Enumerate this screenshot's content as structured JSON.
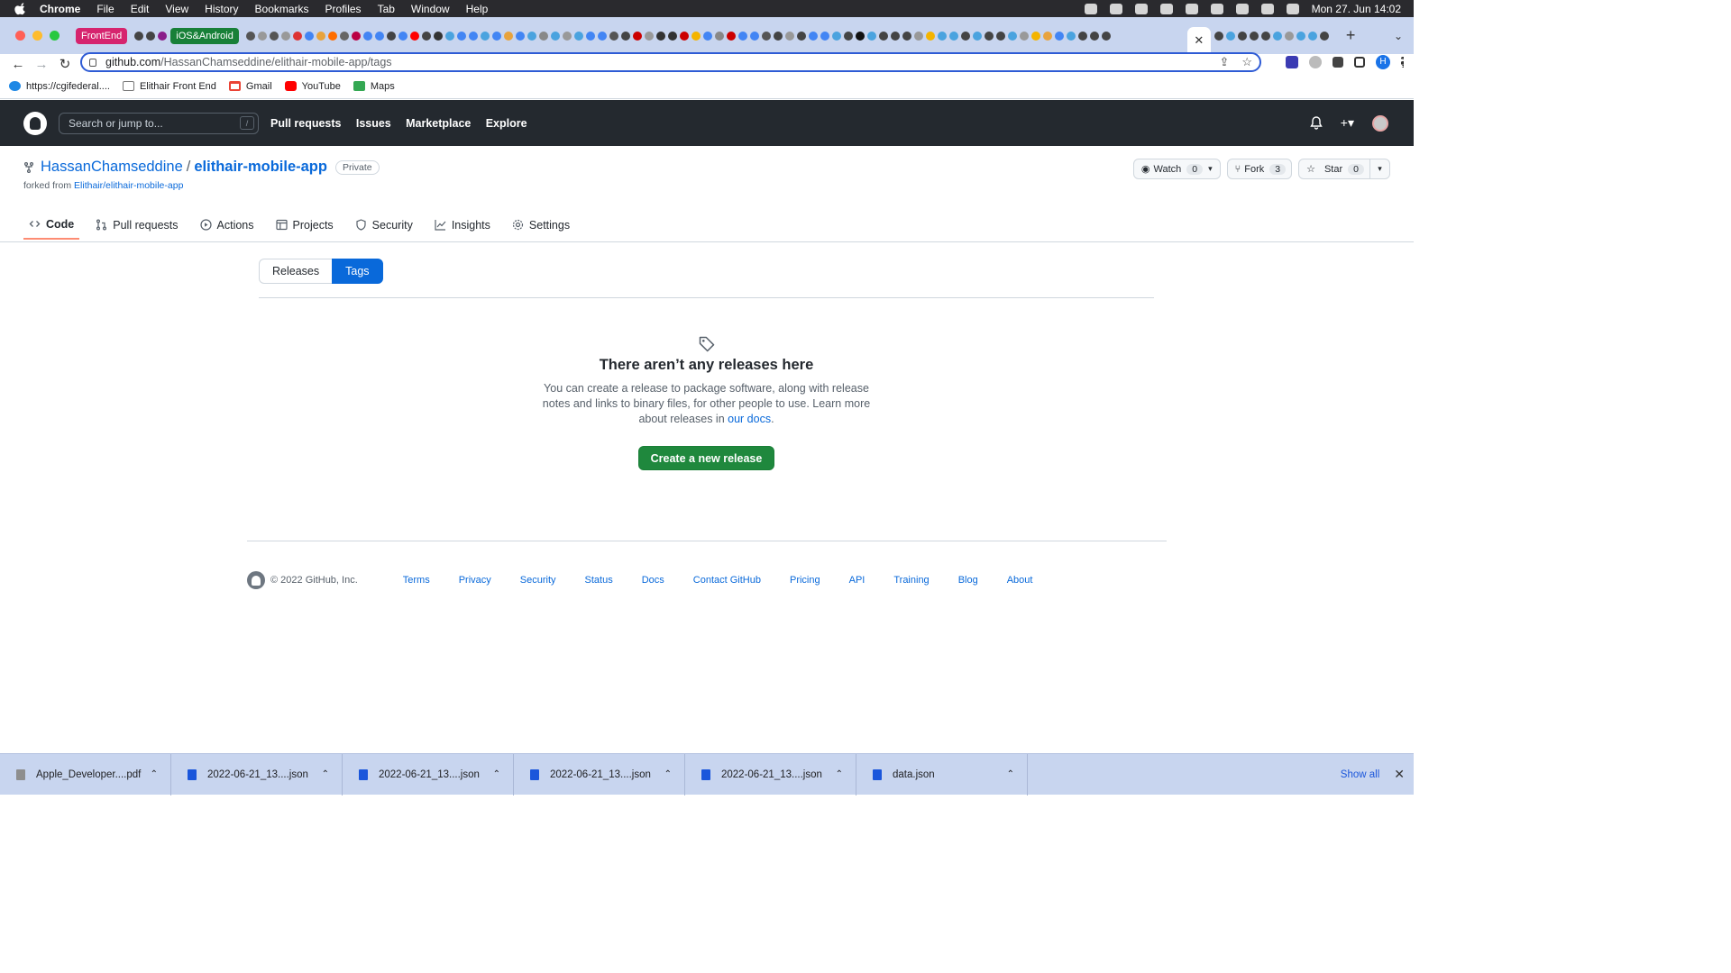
{
  "os_menubar": {
    "app": "Chrome",
    "items": [
      "File",
      "Edit",
      "View",
      "History",
      "Bookmarks",
      "Profiles",
      "Tab",
      "Window",
      "Help"
    ],
    "clock": "Mon 27. Jun  14:02"
  },
  "tabstrip": {
    "group1": {
      "label": "FrontEnd",
      "color": "#d6246e"
    },
    "group2": {
      "label": "iOS&Android",
      "color": "#188038"
    },
    "active_tab_close": "✕",
    "new_tab": "+",
    "tab_menu": "⌄"
  },
  "toolbar": {
    "back": "←",
    "forward": "→",
    "reload": "↻",
    "url_host": "github.com",
    "url_path": "/HassanChamseddine/elithair-mobile-app/tags",
    "profile_initial": "H"
  },
  "bookmarks": [
    {
      "label": "https://cgifederal....",
      "color": "#1e88e5"
    },
    {
      "label": "Elithair Front End",
      "color": "#777777"
    },
    {
      "label": "Gmail",
      "color": "#ea4335"
    },
    {
      "label": "YouTube",
      "color": "#ff0000"
    },
    {
      "label": "Maps",
      "color": "#34a853"
    }
  ],
  "gh_header": {
    "search_placeholder": "Search or jump to...",
    "search_shortcut": "/",
    "nav": [
      "Pull requests",
      "Issues",
      "Marketplace",
      "Explore"
    ]
  },
  "repo": {
    "owner": "HassanChamseddine",
    "separator": "/",
    "name": "elithair-mobile-app",
    "visibility": "Private",
    "forked_prefix": "forked from ",
    "forked_from": "Elithair/elithair-mobile-app",
    "watch": {
      "label": "Watch",
      "count": "0"
    },
    "fork": {
      "label": "Fork",
      "count": "3"
    },
    "star": {
      "label": "Star",
      "count": "0"
    }
  },
  "repo_tabs": [
    "Code",
    "Pull requests",
    "Actions",
    "Projects",
    "Security",
    "Insights",
    "Settings"
  ],
  "subnav": {
    "releases": "Releases",
    "tags": "Tags"
  },
  "blankslate": {
    "title": "There aren’t any releases here",
    "body": "You can create a release to package software, along with release notes and links to binary files, for other people to use. Learn more about releases in ",
    "link": "our docs",
    "end": ".",
    "button": "Create a new release"
  },
  "footer": {
    "copyright": "© 2022 GitHub, Inc.",
    "links": [
      "Terms",
      "Privacy",
      "Security",
      "Status",
      "Docs",
      "Contact GitHub",
      "Pricing",
      "API",
      "Training",
      "Blog",
      "About"
    ]
  },
  "downloads": {
    "items": [
      "Apple_Developer....pdf",
      "2022-06-21_13....json",
      "2022-06-21_13....json",
      "2022-06-21_13....json",
      "2022-06-21_13....json",
      "data.json"
    ],
    "show_all": "Show all",
    "close": "✕"
  }
}
